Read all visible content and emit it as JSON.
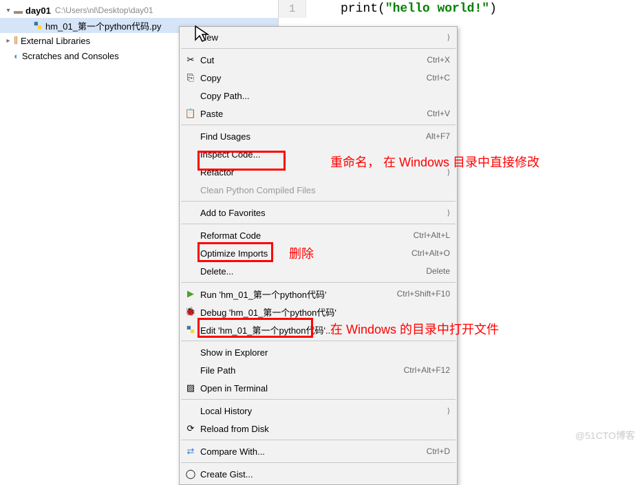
{
  "sidebar": {
    "project_name": "day01",
    "project_path": "C:\\Users\\nl\\Desktop\\day01",
    "file_name": "hm_01_第一个python代码.py",
    "external_libs": "External Libraries",
    "scratches": "Scratches and Consoles"
  },
  "editor": {
    "line_num": "1",
    "code_fn": "print",
    "code_paren_open": "(",
    "code_str": "\"hello world!\"",
    "code_paren_close": ")"
  },
  "menu": {
    "new": "New",
    "cut": "Cut",
    "cut_sc": "Ctrl+X",
    "copy": "Copy",
    "copy_sc": "Ctrl+C",
    "copy_path": "Copy Path...",
    "paste": "Paste",
    "paste_sc": "Ctrl+V",
    "find_usages": "Find Usages",
    "find_usages_sc": "Alt+F7",
    "inspect": "Inspect Code...",
    "refactor": "Refactor",
    "clean_py": "Clean Python Compiled Files",
    "favorites": "Add to Favorites",
    "reformat": "Reformat Code",
    "reformat_sc": "Ctrl+Alt+L",
    "optimize": "Optimize Imports",
    "optimize_sc": "Ctrl+Alt+O",
    "delete": "Delete...",
    "delete_sc": "Delete",
    "run": "Run 'hm_01_第一个python代码'",
    "run_sc": "Ctrl+Shift+F10",
    "debug": "Debug 'hm_01_第一个python代码'",
    "edit": "Edit 'hm_01_第一个python代码'...",
    "show_explorer": "Show in Explorer",
    "file_path": "File Path",
    "file_path_sc": "Ctrl+Alt+F12",
    "terminal": "Open in Terminal",
    "history": "Local History",
    "reload": "Reload from Disk",
    "compare": "Compare With...",
    "compare_sc": "Ctrl+D",
    "gist": "Create Gist..."
  },
  "annotations": {
    "refactor": "重命名，  在 Windows 目录中直接修改",
    "delete": "删除",
    "explorer": "在 Windows 的目录中打开文件"
  },
  "watermark": "@51CTO博客"
}
